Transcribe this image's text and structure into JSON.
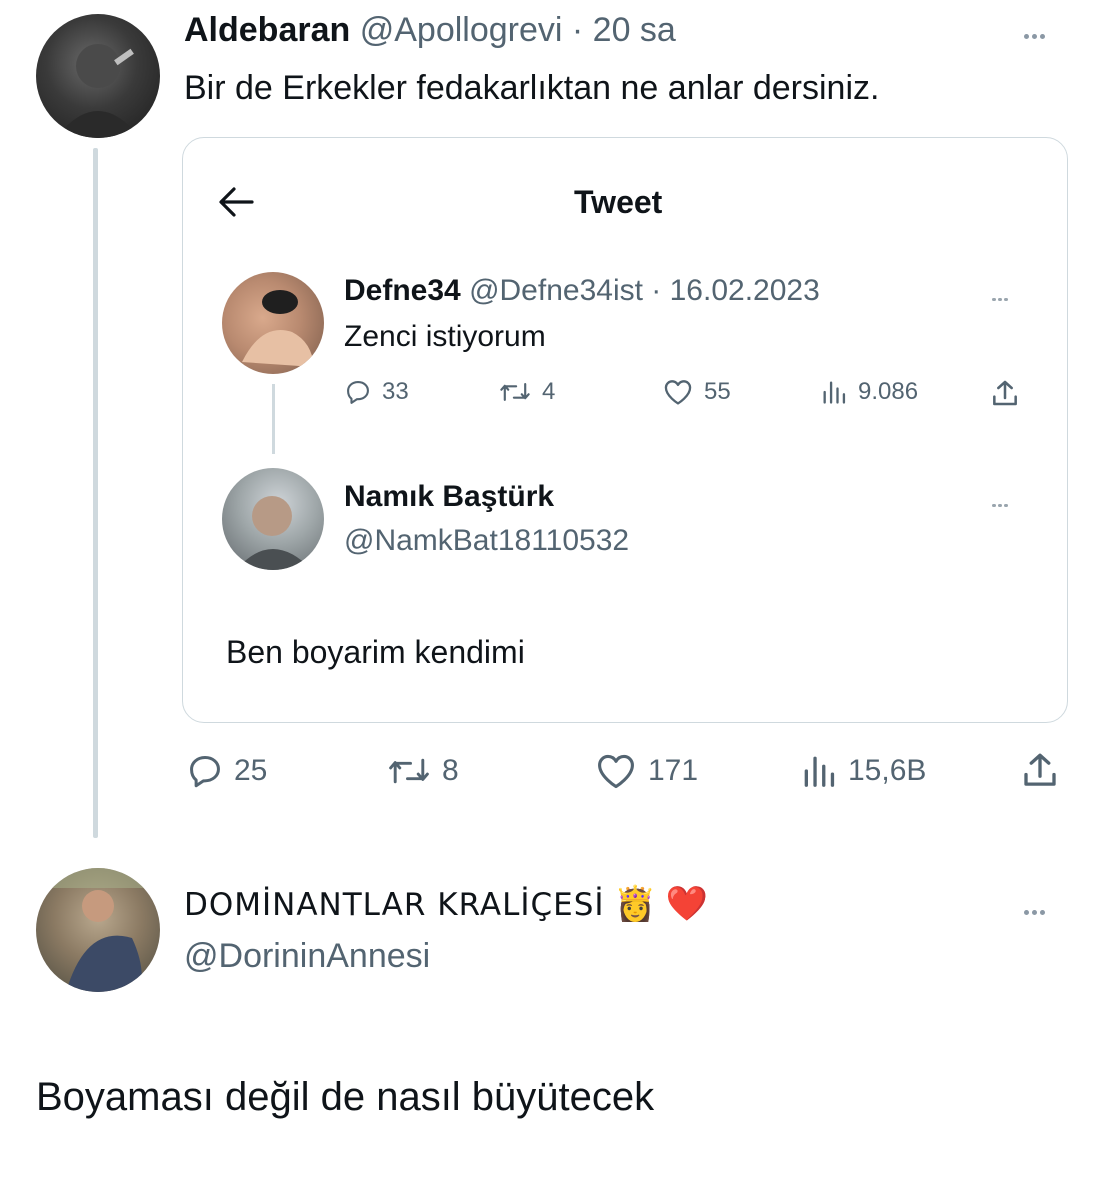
{
  "tweet": {
    "name": "Aldebaran",
    "handle": "@Apollogrevi",
    "time": "20 sa",
    "text": "Bir de Erkekler fedakarlıktan ne anlar dersiniz.",
    "actions": {
      "replies": "25",
      "retweets": "8",
      "likes": "171",
      "views": "15,6B"
    }
  },
  "embed": {
    "header_title": "Tweet",
    "post1": {
      "name": "Defne34",
      "handle": "@Defne34ist",
      "date": "16.02.2023",
      "text": "Zenci istiyorum",
      "actions": {
        "replies": "33",
        "retweets": "4",
        "likes": "55",
        "views": "9.086"
      }
    },
    "post2": {
      "name": "Namık Baştürk",
      "handle": "@NamkBat18110532",
      "text": "Ben boyarim kendimi"
    }
  },
  "reply": {
    "name": "DOMİNANTLAR KRALİÇESİ",
    "emojis": "👸 ❤️",
    "handle": "@DorininAnnesi",
    "text": "Boyaması değil de nasıl büyütecek"
  },
  "colors": {
    "text": "#0f1419",
    "muted": "#536471",
    "thread_line": "#cfd9de",
    "border": "#cfd9de"
  }
}
